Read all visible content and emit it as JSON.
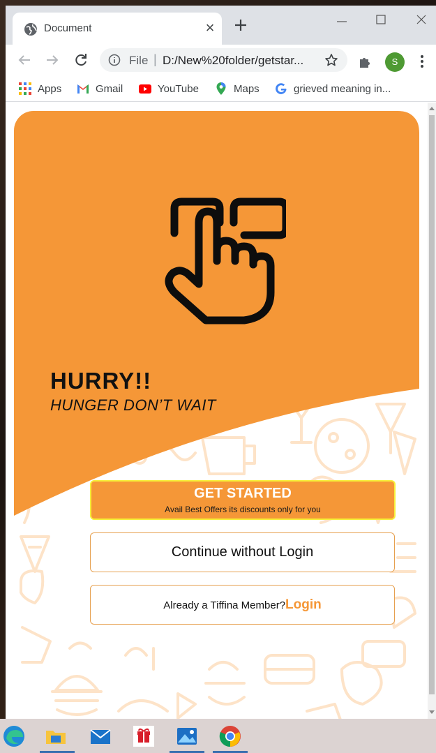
{
  "browser": {
    "tab_title": "Document",
    "omnibox_scheme": "File",
    "omnibox_separator": "|",
    "url": "D:/New%20folder/getstar...",
    "profile_initial": "S"
  },
  "bookmarks": [
    {
      "label": "Apps",
      "icon": "apps-grid-icon"
    },
    {
      "label": "Gmail",
      "icon": "gmail-icon"
    },
    {
      "label": "YouTube",
      "icon": "youtube-icon"
    },
    {
      "label": "Maps",
      "icon": "maps-icon"
    },
    {
      "label": "grieved meaning in...",
      "icon": "google-icon"
    }
  ],
  "page": {
    "headline": "HURRY!!",
    "tagline": "HUNGER DON’T WAIT",
    "get_started": {
      "label": "GET STARTED",
      "subtext": "Avail Best Offers its discounts only for you"
    },
    "continue_label": "Continue without Login",
    "member_question": "Already a Tiffina Member?",
    "login_link": "Login"
  },
  "taskbar": [
    "edge-icon",
    "file-explorer-icon",
    "mail-icon",
    "gift-app-icon",
    "photos-icon",
    "chrome-icon"
  ],
  "colors": {
    "accent_orange": "#f59737",
    "highlight_yellow": "#f7f03a",
    "avatar_green": "#4e9a33"
  }
}
